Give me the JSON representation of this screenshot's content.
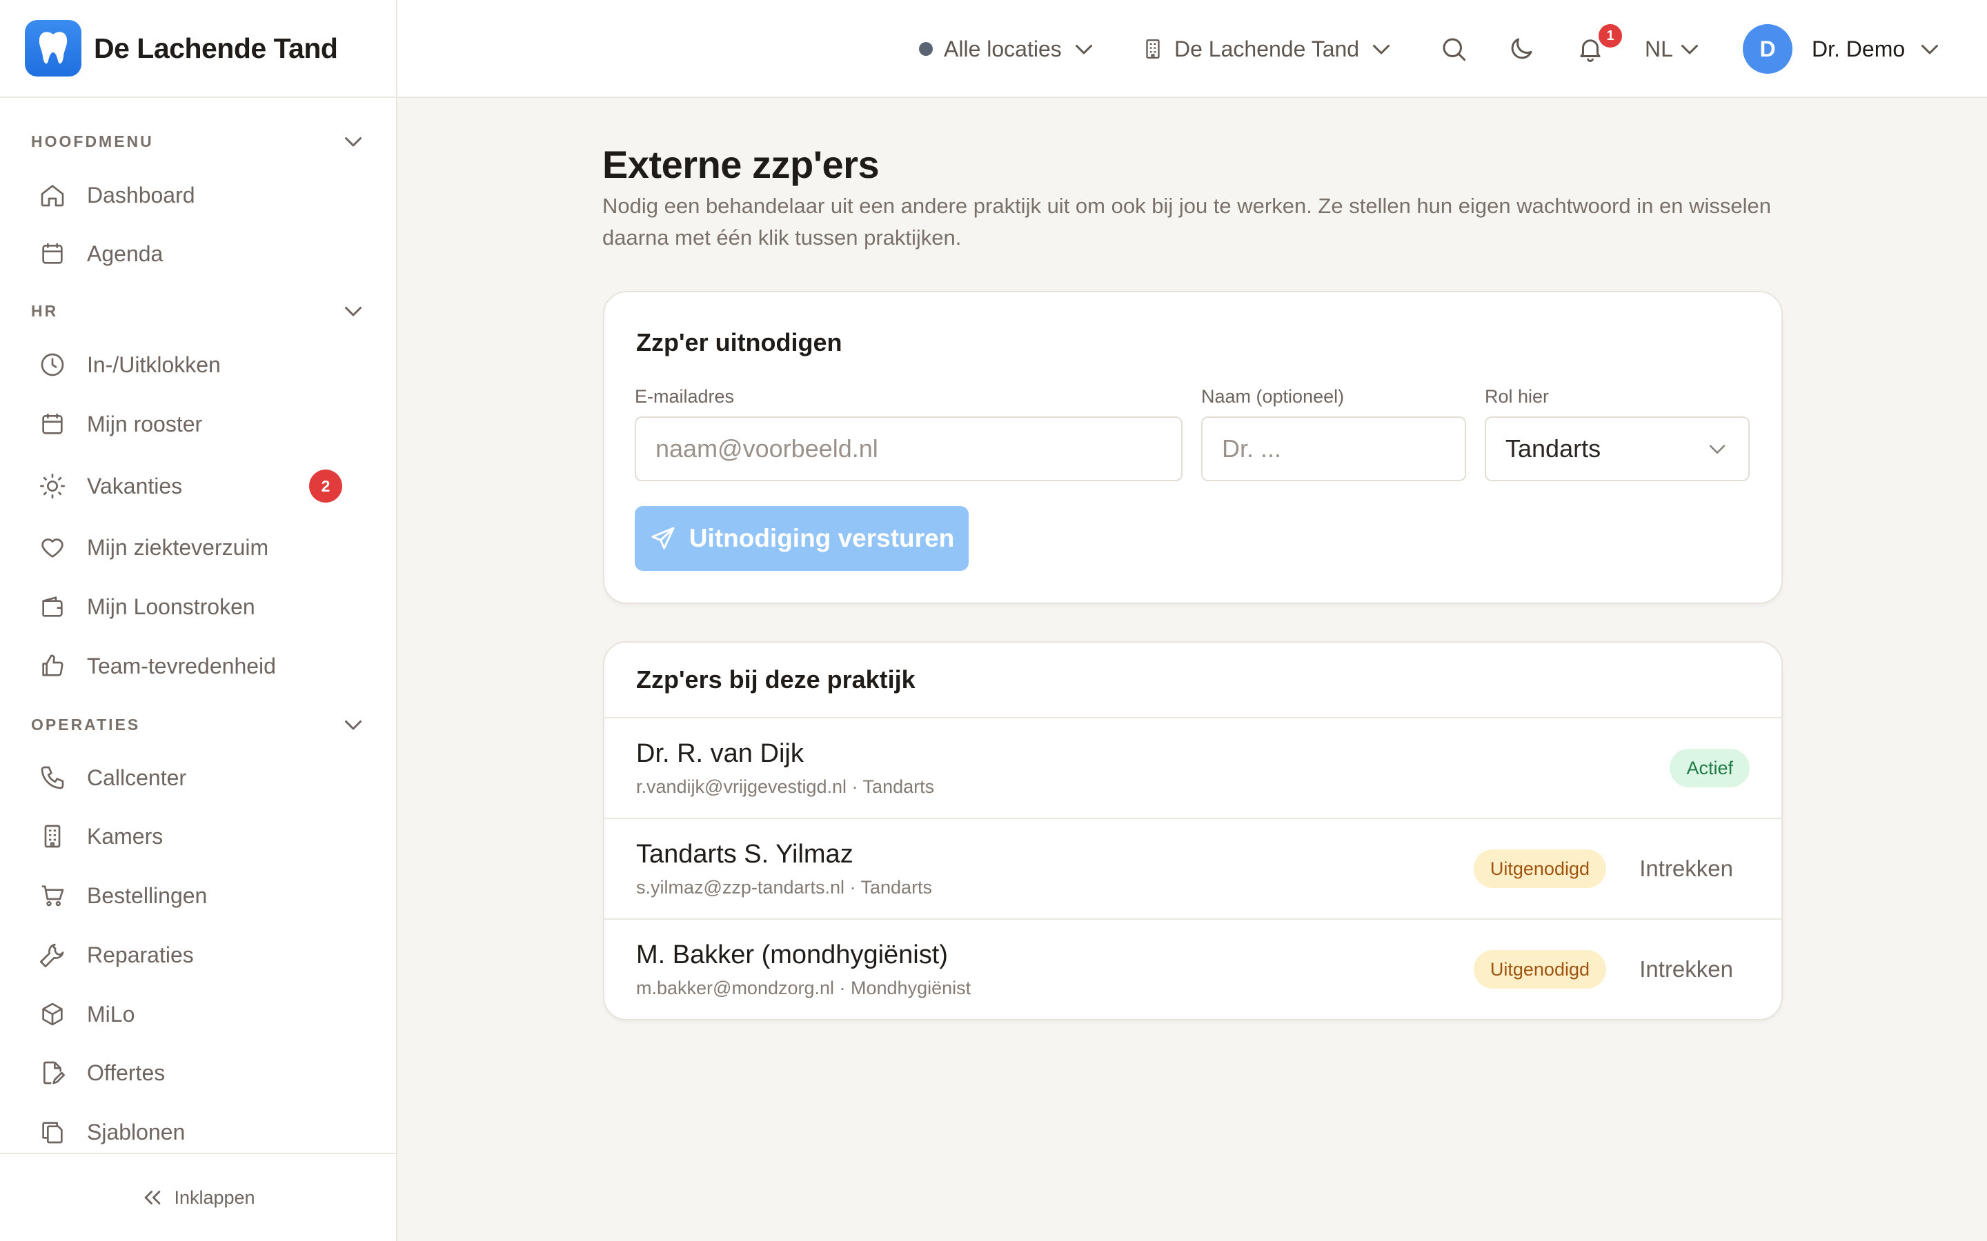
{
  "brand": {
    "name": "De Lachende Tand"
  },
  "sidebar": {
    "sections": [
      {
        "label": "HOOFDMENU",
        "items": [
          {
            "label": "Dashboard",
            "icon": "home-icon"
          },
          {
            "label": "Agenda",
            "icon": "calendar-icon"
          }
        ]
      },
      {
        "label": "HR",
        "items": [
          {
            "label": "In-/Uitklokken",
            "icon": "clock-icon"
          },
          {
            "label": "Mijn rooster",
            "icon": "calendar-icon"
          },
          {
            "label": "Vakanties",
            "icon": "sun-icon",
            "badge": "2"
          },
          {
            "label": "Mijn ziekteverzuim",
            "icon": "heart-icon"
          },
          {
            "label": "Mijn Loonstroken",
            "icon": "wallet-icon"
          },
          {
            "label": "Team-tevredenheid",
            "icon": "thumbs-up-icon"
          }
        ]
      },
      {
        "label": "OPERATIES",
        "items": [
          {
            "label": "Callcenter",
            "icon": "phone-icon"
          },
          {
            "label": "Kamers",
            "icon": "building-icon"
          },
          {
            "label": "Bestellingen",
            "icon": "cart-icon"
          },
          {
            "label": "Reparaties",
            "icon": "wrench-icon"
          },
          {
            "label": "MiLo",
            "icon": "box-icon"
          },
          {
            "label": "Offertes",
            "icon": "file-edit-icon"
          },
          {
            "label": "Sjablonen",
            "icon": "copy-icon"
          }
        ]
      }
    ],
    "collapse_label": "Inklappen"
  },
  "topbar": {
    "location": "Alle locaties",
    "practice": "De Lachende Tand",
    "notification_count": "1",
    "language": "NL",
    "user": {
      "initial": "D",
      "name": "Dr. Demo"
    }
  },
  "page": {
    "title": "Externe zzp'ers",
    "description": "Nodig een behandelaar uit een andere praktijk uit om ook bij jou te werken. Ze stellen hun eigen wachtwoord in en wisselen daarna met één klik tussen praktijken."
  },
  "invite": {
    "title": "Zzp'er uitnodigen",
    "email_label": "E-mailadres",
    "email_placeholder": "naam@voorbeeld.nl",
    "name_label": "Naam (optioneel)",
    "name_placeholder": "Dr. ...",
    "role_label": "Rol hier",
    "role_value": "Tandarts",
    "submit_label": "Uitnodiging versturen"
  },
  "list": {
    "title": "Zzp'ers bij deze praktijk",
    "revoke_label": "Intrekken",
    "rows": [
      {
        "name": "Dr. R. van Dijk",
        "sub": "r.vandijk@vrijgevestigd.nl · Tandarts",
        "status": "Actief"
      },
      {
        "name": "Tandarts S. Yilmaz",
        "sub": "s.yilmaz@zzp-tandarts.nl · Tandarts",
        "status": "Uitgenodigd"
      },
      {
        "name": "M. Bakker (mondhygiënist)",
        "sub": "m.bakker@mondzorg.nl · Mondhygiënist",
        "status": "Uitgenodigd"
      }
    ]
  },
  "colors": {
    "accent": "#1f6fe0",
    "button_disabled": "#93c4f7",
    "badge_red": "#e23b3b",
    "status_active_bg": "#dcf6e6",
    "status_active_text": "#1f7a45",
    "status_invited_bg": "#fdf0c8",
    "status_invited_text": "#a0520f"
  }
}
